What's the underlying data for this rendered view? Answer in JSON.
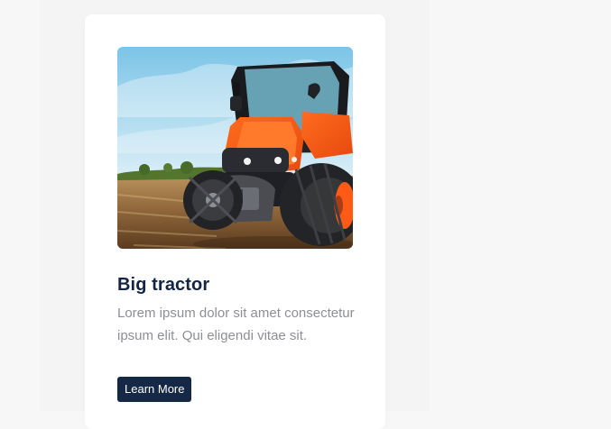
{
  "card": {
    "image_subject": "tractor-image",
    "title": "Big tractor",
    "description": "Lorem ipsum dolor sit amet consectetur ipsum elit. Qui eligendi vitae sit.",
    "button_label": "Learn More"
  },
  "colors": {
    "page_background": "#f7f7f7",
    "card_background": "#ffffff",
    "title": "#132542",
    "body_text": "#8d8f94",
    "button_background": "#152845",
    "button_text": "#ffffff"
  }
}
